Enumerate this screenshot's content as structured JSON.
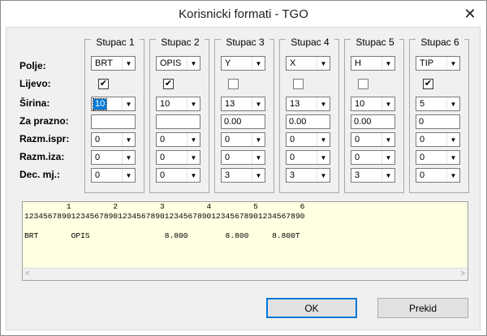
{
  "window": {
    "title": "Korisnicki formati - TGO",
    "close_glyph": "✕"
  },
  "rows": {
    "polje": "Polje:",
    "lijevo": "Lijevo:",
    "sirina": "Širina:",
    "za_prazno": "Za prazno:",
    "razm_ispr": "Razm.ispr:",
    "razm_iza": "Razm.iza:",
    "dec_mj": "Dec. mj.:"
  },
  "columns": [
    {
      "title": "Stupac 1",
      "polje": "BRT",
      "lijevo": true,
      "sirina": "10",
      "za_prazno": "",
      "razm_ispr": "0",
      "razm_iza": "0",
      "dec_mj": "0"
    },
    {
      "title": "Stupac 2",
      "polje": "OPIS",
      "lijevo": true,
      "sirina": "10",
      "za_prazno": "",
      "razm_ispr": "0",
      "razm_iza": "0",
      "dec_mj": "0"
    },
    {
      "title": "Stupac 3",
      "polje": "Y",
      "lijevo": false,
      "sirina": "13",
      "za_prazno": "0.00",
      "razm_ispr": "0",
      "razm_iza": "0",
      "dec_mj": "3"
    },
    {
      "title": "Stupac 4",
      "polje": "X",
      "lijevo": false,
      "sirina": "13",
      "za_prazno": "0.00",
      "razm_ispr": "0",
      "razm_iza": "0",
      "dec_mj": "3"
    },
    {
      "title": "Stupac 5",
      "polje": "H",
      "lijevo": false,
      "sirina": "10",
      "za_prazno": "0.00",
      "razm_ispr": "0",
      "razm_iza": "0",
      "dec_mj": "3"
    },
    {
      "title": "Stupac 6",
      "polje": "TIP",
      "lijevo": true,
      "sirina": "5",
      "za_prazno": "0",
      "razm_ispr": "0",
      "razm_iza": "0",
      "dec_mj": "0"
    }
  ],
  "preview": {
    "ruler_tens": "         1         2         3         4         5         6",
    "ruler_ones": "123456789012345678901234567890123456789012345678901234567890",
    "blank": "",
    "sample": "BRT       OPIS                8.800        8.800     8.800T"
  },
  "buttons": {
    "ok": "OK",
    "cancel": "Prekid"
  },
  "icons": {
    "combo_arrow": "▼",
    "check": "✔",
    "scroll_left": "<",
    "scroll_right": ">"
  }
}
